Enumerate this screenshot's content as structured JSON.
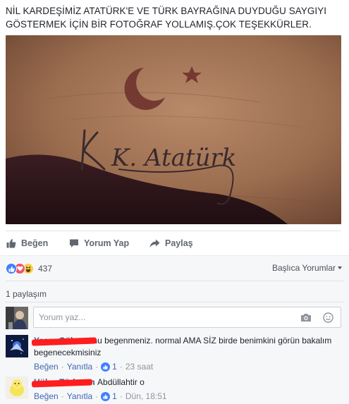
{
  "post": {
    "text": "NİL KARDEŞİMİZ ATATÜRK'E VE TÜRK BAYRAĞINA DUYDUĞU SAYGIYI GÖSTERMEK İÇİN BİR FOTOĞRAF YOLLAMIŞ.ÇOK TEŞEKKÜRLER.",
    "photo_signature": "K. Atatürk"
  },
  "actions": {
    "like": "Beğen",
    "comment": "Yorum Yap",
    "share": "Paylaş"
  },
  "feedback": {
    "reaction_count": "437",
    "reaction_icons": [
      "like-icon",
      "love-icon",
      "haha-icon"
    ],
    "sort_label": "Başlıca Yorumlar",
    "shares": "1 paylaşım"
  },
  "composer": {
    "placeholder": "Yorum yaz..."
  },
  "comments": [
    {
      "author": "Yaşar Gülser",
      "text": "onu begenmeniz. normal AMA SİZ birde benimkini görün bakalım begenecekmisiniz",
      "like": "Beğen",
      "reply": "Yanıtla",
      "likes": "1",
      "time": "23 saat"
    },
    {
      "author": "Hülya Türkmen",
      "text": "Abdüllahtir o",
      "like": "Beğen",
      "reply": "Yanıtla",
      "likes": "1",
      "time": "Dün, 18:51"
    }
  ],
  "colors": {
    "link": "#365899",
    "like_blue": "#4080ff",
    "love_red": "#f25268",
    "haha_yellow": "#fccd43",
    "redaction": "#ff1d1d"
  }
}
